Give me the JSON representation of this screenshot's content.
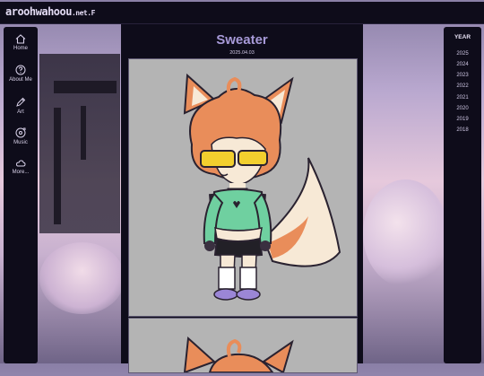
{
  "site": {
    "logo_text": "aroohwahoou",
    "logo_tld": ".net.F"
  },
  "nav": {
    "items": [
      {
        "label": "Home",
        "icon": "home-icon"
      },
      {
        "label": "About Me",
        "icon": "question-circle-icon"
      },
      {
        "label": "Art",
        "icon": "pencil-icon"
      },
      {
        "label": "Music",
        "icon": "music-disc-icon"
      },
      {
        "label": "More...",
        "icon": "cloud-icon"
      }
    ]
  },
  "post": {
    "title": "Sweater",
    "date": "2025.04.03"
  },
  "year_panel": {
    "heading": "YEAR",
    "years": [
      "2025",
      "2024",
      "2023",
      "2022",
      "2021",
      "2020",
      "2019",
      "2018"
    ]
  },
  "colors": {
    "panel_bg": "#0e0c1a",
    "title_accent": "#a79ad8",
    "text_light": "#d9d2ea",
    "art_bg": "#b4b4b4"
  }
}
